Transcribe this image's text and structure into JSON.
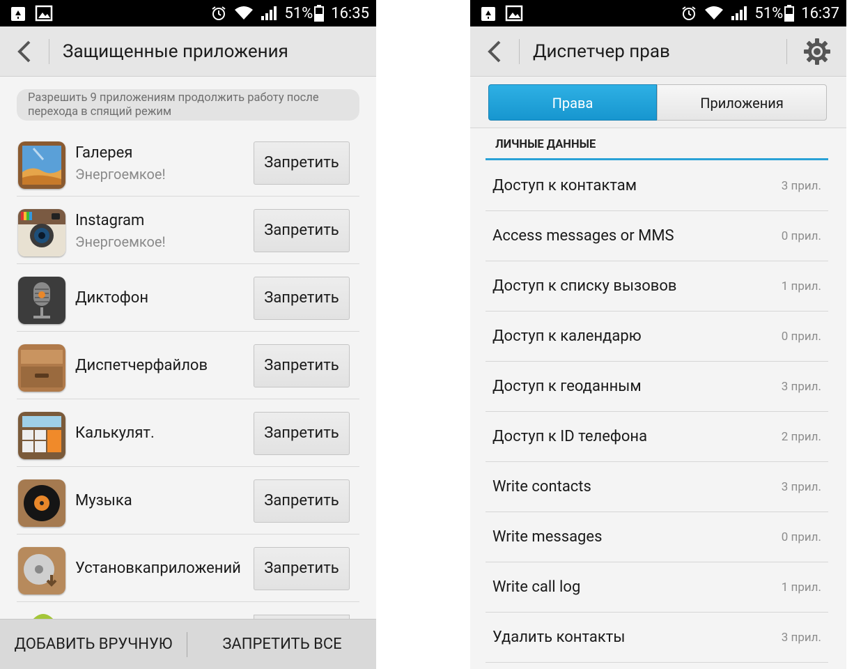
{
  "left": {
    "status": {
      "battery": "51%",
      "time": "16:35"
    },
    "title": "Защищенные приложения",
    "notice": "Разрешить 9 приложениям продолжить работу после перехода в спящий режим",
    "deny_label": "Запретить",
    "apps": [
      {
        "name": "Галерея",
        "sub": "Энергоемкое!",
        "icon": "gallery-icon"
      },
      {
        "name": "Instagram",
        "sub": "Энергоемкое!",
        "icon": "instagram-icon"
      },
      {
        "name": "Диктофон",
        "sub": "",
        "icon": "recorder-icon"
      },
      {
        "name": "Диспетчерфайлов",
        "sub": "",
        "icon": "file-manager-icon"
      },
      {
        "name": "Калькулят.",
        "sub": "",
        "icon": "calculator-icon"
      },
      {
        "name": "Музыка",
        "sub": "",
        "icon": "music-icon"
      },
      {
        "name": "Установкаприложений",
        "sub": "",
        "icon": "app-installer-icon"
      }
    ],
    "bottom": {
      "add_manually": "ДОБАВИТЬ ВРУЧНУЮ",
      "deny_all": "ЗАПРЕТИТЬ ВСЕ"
    },
    "colors": {
      "actionbar": "#e6e6e6",
      "background": "#f4f4f4"
    }
  },
  "right": {
    "status": {
      "battery": "51%",
      "time": "16:37"
    },
    "title": "Диспетчер прав",
    "tabs": {
      "active": "Права",
      "inactive": "Приложения"
    },
    "section": "ЛИЧНЫЕ ДАННЫЕ",
    "permissions": [
      {
        "label": "Доступ к контактам",
        "count": "3 прил."
      },
      {
        "label": "Access messages or MMS",
        "count": "0 прил."
      },
      {
        "label": "Доступ к списку вызовов",
        "count": "1 прил."
      },
      {
        "label": "Доступ к календарю",
        "count": "0 прил."
      },
      {
        "label": "Доступ к геоданным",
        "count": "3 прил."
      },
      {
        "label": "Доступ к ID телефона",
        "count": "2 прил."
      },
      {
        "label": "Write contacts",
        "count": "3 прил."
      },
      {
        "label": "Write messages",
        "count": "0 прил."
      },
      {
        "label": "Write call log",
        "count": "1 прил."
      },
      {
        "label": "Удалить контакты",
        "count": "3 прил."
      }
    ],
    "colors": {
      "accent": "#1da2dc"
    }
  }
}
